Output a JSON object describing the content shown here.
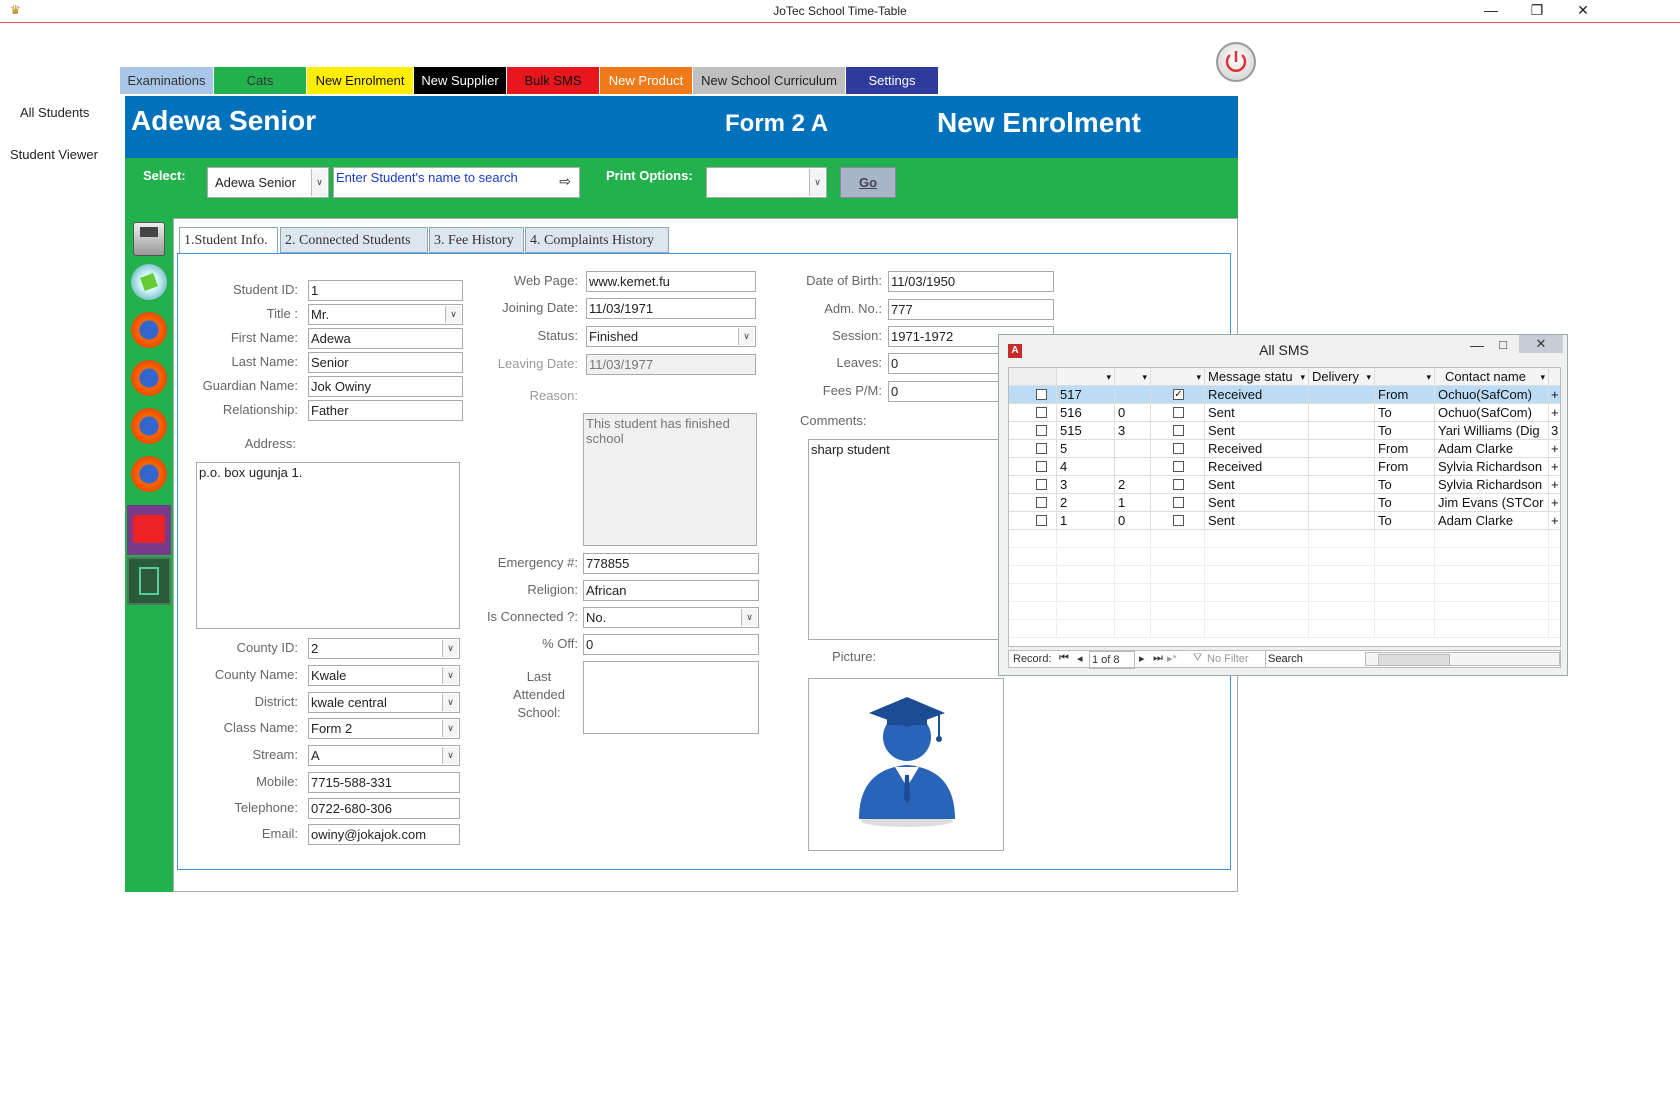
{
  "window": {
    "title": "JoTec School Time-Table",
    "min": "—",
    "restore": "❐",
    "close": "✕"
  },
  "leftnav": {
    "items": [
      "All Students",
      "Student Viewer"
    ]
  },
  "tabs": [
    {
      "label": "Examinations",
      "bg": "#a9c6e8",
      "fg": "#333"
    },
    {
      "label": "Cats",
      "bg": "#23b14d",
      "fg": "#333"
    },
    {
      "label": "New Enrolment",
      "bg": "#ffee00",
      "fg": "#111"
    },
    {
      "label": "New Supplier",
      "bg": "#000000",
      "fg": "#ffffff"
    },
    {
      "label": "Bulk SMS",
      "bg": "#e8161d",
      "fg": "#111"
    },
    {
      "label": "New Product",
      "bg": "#f07a1a",
      "fg": "#ffffff"
    },
    {
      "label": "New School Curriculum",
      "bg": "#c0c0c0",
      "fg": "#222"
    },
    {
      "label": "Settings",
      "bg": "#2e3a9c",
      "fg": "#ffffff"
    }
  ],
  "header": {
    "name": "Adewa Senior",
    "form": "Form 2 A",
    "mode": "New Enrolment"
  },
  "select": {
    "label": "Select:",
    "value": "Adewa Senior",
    "search_placeholder": "Enter Student's name to search",
    "print_label": "Print Options:",
    "print_value": "",
    "go": "Go"
  },
  "formtabs": [
    "1.Student Info.",
    "2. Connected Students",
    "3. Fee History",
    "4. Complaints History"
  ],
  "col1": {
    "student_id": {
      "label": "Student ID:",
      "value": "1"
    },
    "title": {
      "label": "Title :",
      "value": "Mr."
    },
    "first_name": {
      "label": "First Name:",
      "value": "Adewa"
    },
    "last_name": {
      "label": "Last Name:",
      "value": "Senior"
    },
    "guardian": {
      "label": "Guardian Name:",
      "value": "Jok Owiny"
    },
    "relationship": {
      "label": "Relationship:",
      "value": "Father"
    },
    "address": {
      "label": "Address:",
      "value": "p.o. box ugunja 1."
    },
    "county_id": {
      "label": "County ID:",
      "value": "2"
    },
    "county_name": {
      "label": "County Name:",
      "value": "Kwale"
    },
    "district": {
      "label": "District:",
      "value": "kwale central"
    },
    "class_name": {
      "label": "Class Name:",
      "value": "Form 2"
    },
    "stream": {
      "label": "Stream:",
      "value": "A"
    },
    "mobile": {
      "label": "Mobile:",
      "value": "7715-588-331"
    },
    "telephone": {
      "label": "Telephone:",
      "value": "0722-680-306"
    },
    "email": {
      "label": "Email:",
      "value": "owiny@jokajok.com"
    }
  },
  "col2": {
    "web": {
      "label": "Web Page:",
      "value": "www.kemet.fu"
    },
    "joining": {
      "label": "Joining Date:",
      "value": "11/03/1971"
    },
    "status": {
      "label": "Status:",
      "value": "Finished"
    },
    "leaving": {
      "label": "Leaving Date:",
      "value": "11/03/1977"
    },
    "reason": {
      "label": "Reason:",
      "value": "This student has finished school"
    },
    "emergency": {
      "label": "Emergency #:",
      "value": "778855"
    },
    "religion": {
      "label": "Religion:",
      "value": "African"
    },
    "connected": {
      "label": "Is Connected ?:",
      "value": "No."
    },
    "off": {
      "label": "% Off:",
      "value": "0"
    },
    "last_school": {
      "label": "Last Attended School:",
      "value": ""
    }
  },
  "col3": {
    "dob": {
      "label": "Date of Birth:",
      "value": "11/03/1950"
    },
    "adm": {
      "label": "Adm. No.:",
      "value": "777"
    },
    "session": {
      "label": "Session:",
      "value": "1971-1972"
    },
    "leaves": {
      "label": "Leaves:",
      "value": "0"
    },
    "fees": {
      "label": "Fees P/M:",
      "value": "0"
    },
    "comments": {
      "label": "Comments:",
      "value": "sharp student"
    },
    "picture": {
      "label": "Picture:"
    }
  },
  "sms": {
    "title": "All SMS",
    "headers": [
      "",
      "",
      "",
      "Message statu",
      "Delivery",
      "",
      "Contact name"
    ],
    "rows": [
      {
        "id": "517",
        "n": "",
        "checked": true,
        "status": "Received",
        "dir": "From",
        "contact": "Ochuo(SafCom)",
        "plus": "+"
      },
      {
        "id": "516",
        "n": "0",
        "checked": false,
        "status": "Sent",
        "dir": "To",
        "contact": "Ochuo(SafCom)",
        "plus": "+"
      },
      {
        "id": "515",
        "n": "3",
        "checked": false,
        "status": "Sent",
        "dir": "To",
        "contact": "Yari Williams (Dig",
        "plus": "3"
      },
      {
        "id": "5",
        "n": "",
        "checked": false,
        "status": "Received",
        "dir": "From",
        "contact": "Adam Clarke",
        "plus": "+"
      },
      {
        "id": "4",
        "n": "",
        "checked": false,
        "status": "Received",
        "dir": "From",
        "contact": "Sylvia Richardson",
        "plus": "+"
      },
      {
        "id": "3",
        "n": "2",
        "checked": false,
        "status": "Sent",
        "dir": "To",
        "contact": "Sylvia Richardson",
        "plus": "+"
      },
      {
        "id": "2",
        "n": "1",
        "checked": false,
        "status": "Sent",
        "dir": "To",
        "contact": "Jim Evans (STCor",
        "plus": "+"
      },
      {
        "id": "1",
        "n": "0",
        "checked": false,
        "status": "Sent",
        "dir": "To",
        "contact": "Adam Clarke",
        "plus": "+"
      }
    ],
    "record_label": "Record:",
    "record_value": "1 of 8",
    "nofilter": "No Filter",
    "search": "Search"
  }
}
